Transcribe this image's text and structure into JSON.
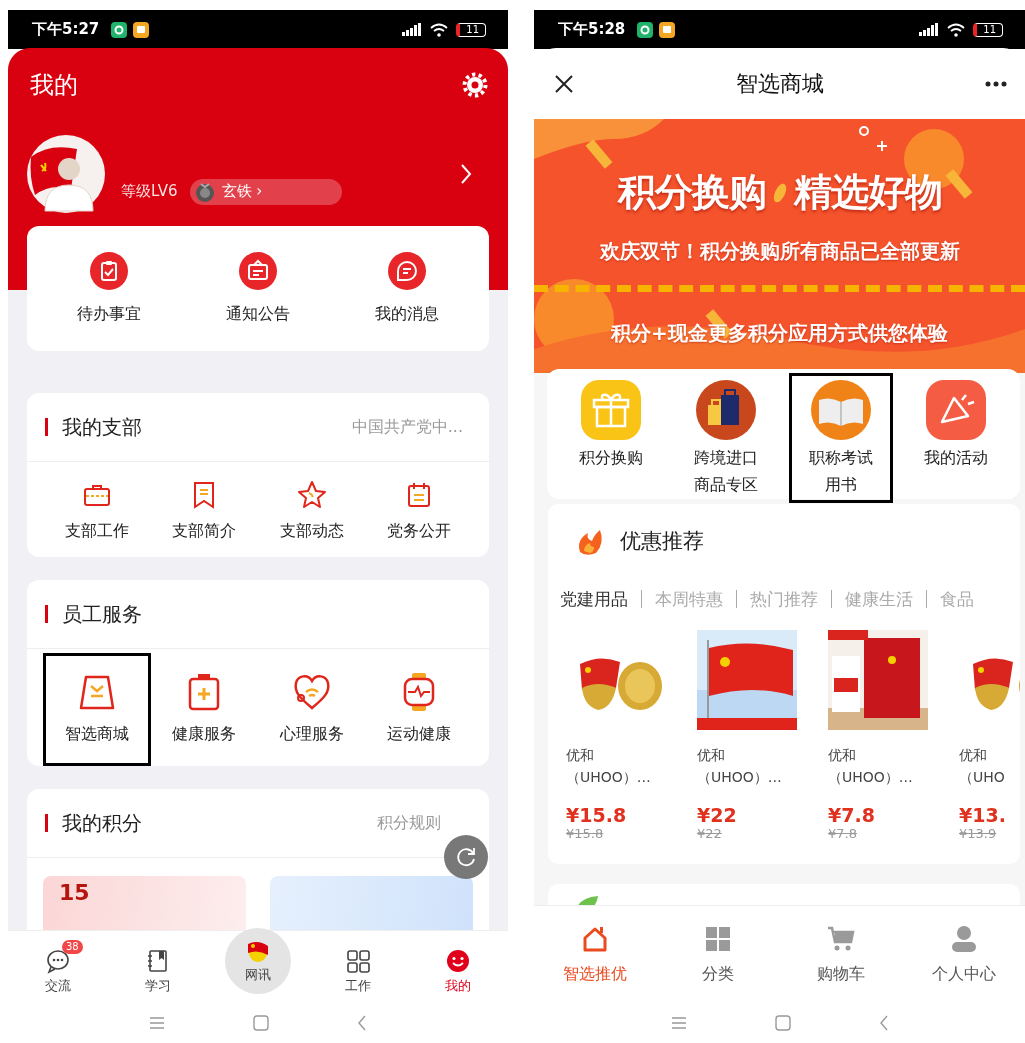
{
  "left_screen": {
    "status_bar": {
      "time": "下午5:27",
      "battery": "11"
    },
    "title": "我的",
    "profile": {
      "level": "等级LV6",
      "rank": "玄铁 ›"
    },
    "quick_actions": [
      {
        "label": "待办事宜"
      },
      {
        "label": "通知公告"
      },
      {
        "label": "我的消息"
      }
    ],
    "sections": [
      {
        "title": "我的支部",
        "link": "中国共产党中...",
        "items": [
          {
            "label": "支部工作",
            "highlighted": false
          },
          {
            "label": "支部简介",
            "highlighted": false
          },
          {
            "label": "支部动态",
            "highlighted": false
          },
          {
            "label": "党务公开",
            "highlighted": false
          }
        ]
      },
      {
        "title": "员工服务",
        "items": [
          {
            "label": "智选商城",
            "highlighted": true
          },
          {
            "label": "健康服务",
            "highlighted": false
          },
          {
            "label": "心理服务",
            "highlighted": false
          },
          {
            "label": "运动健康",
            "highlighted": false
          }
        ]
      }
    ],
    "points": {
      "title": "我的积分",
      "link": "积分规则",
      "card_value": "15"
    },
    "tab_bar": [
      {
        "label": "交流",
        "kind": "regular",
        "badge": "38",
        "selected": false
      },
      {
        "label": "学习",
        "kind": "regular",
        "selected": false
      },
      {
        "label": "网讯",
        "kind": "raised",
        "selected": false
      },
      {
        "label": "工作",
        "kind": "regular",
        "selected": false
      },
      {
        "label": "我的",
        "kind": "regular",
        "selected": true
      }
    ]
  },
  "right_screen": {
    "status_bar": {
      "time": "下午5:28",
      "battery": "11"
    },
    "title": "智选商城",
    "banner": {
      "headline": [
        "积分换购",
        "精选好物"
      ],
      "subtitle": "欢庆双节！积分换购所有商品已全部更新",
      "footer": "积分+现金更多积分应用方式供您体验"
    },
    "categories": [
      {
        "label": "积分换购",
        "highlighted": false
      },
      {
        "label": "跨境进口商品专区",
        "highlighted": false
      },
      {
        "label": "职称考试用书",
        "highlighted": true
      },
      {
        "label": "我的活动",
        "highlighted": false
      }
    ],
    "recommend": {
      "title": "优惠推荐",
      "filters": [
        {
          "label": "党建用品",
          "selected": true
        },
        {
          "label": "本周特惠",
          "selected": false
        },
        {
          "label": "热门推荐",
          "selected": false
        },
        {
          "label": "健康生活",
          "selected": false
        },
        {
          "label": "食品",
          "selected": false
        }
      ],
      "products": [
        {
          "name": "优和（UHOO）…",
          "price": "¥15.8",
          "original_price": "¥15.8"
        },
        {
          "name": "优和（UHOO）…",
          "price": "¥22",
          "original_price": "¥22"
        },
        {
          "name": "优和（UHOO）…",
          "price": "¥7.8",
          "original_price": "¥7.8"
        },
        {
          "name": "优和（UHO",
          "price": "¥13.",
          "original_price": "¥13.9"
        }
      ]
    },
    "tab_bar": [
      {
        "label": "智选推优",
        "selected": true
      },
      {
        "label": "分类",
        "selected": false
      },
      {
        "label": "购物车",
        "selected": false
      },
      {
        "label": "个人中心",
        "selected": false
      }
    ]
  }
}
